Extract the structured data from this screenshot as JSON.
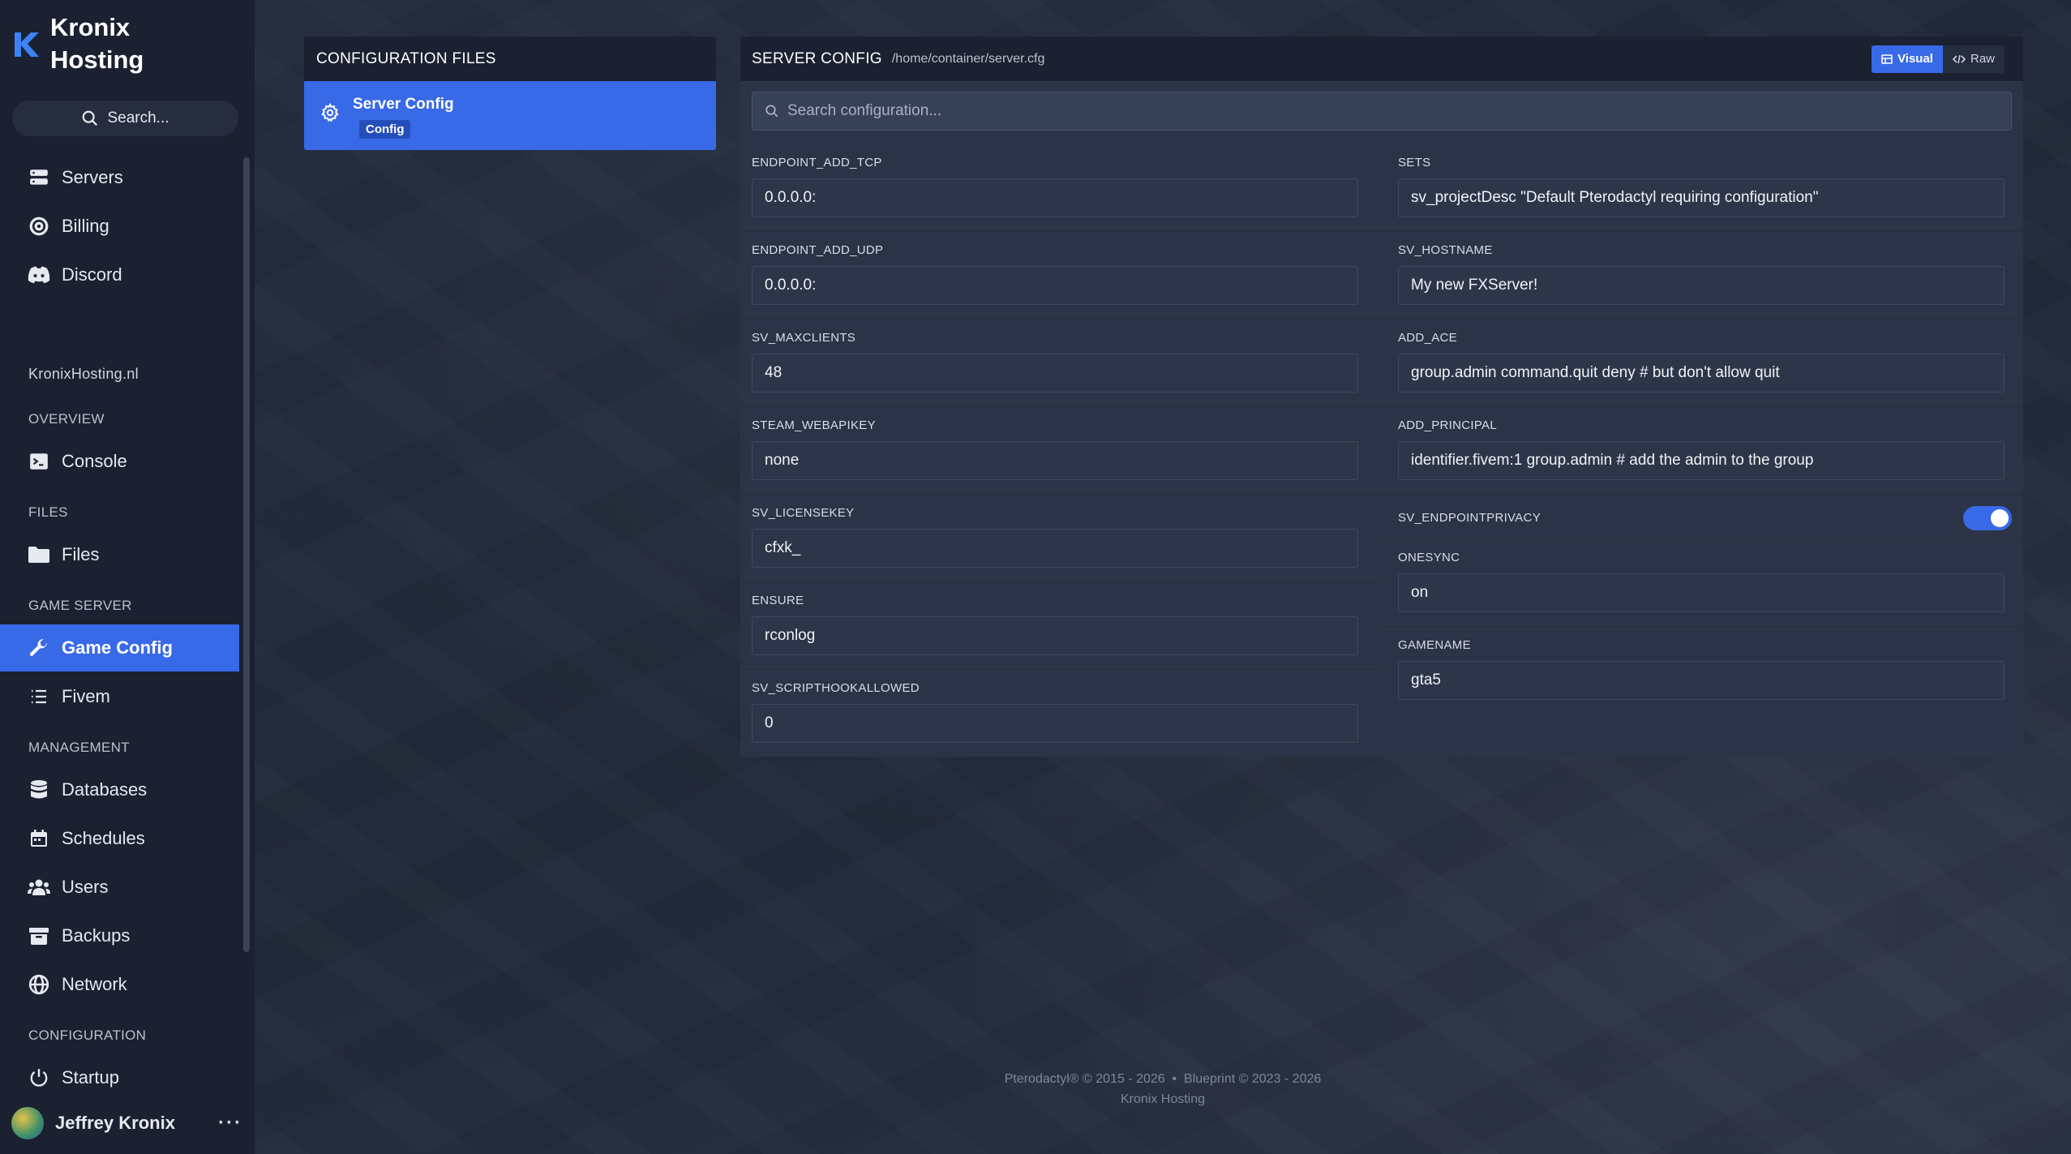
{
  "brand": {
    "line1": "Kronix",
    "line2": "Hosting"
  },
  "sidebar": {
    "search_label": "Search...",
    "top_items": [
      {
        "label": "Servers",
        "icon": "server-icon"
      },
      {
        "label": "Billing",
        "icon": "lifebuoy-icon"
      },
      {
        "label": "Discord",
        "icon": "discord-icon"
      }
    ],
    "site_label": "KronixHosting.nl",
    "sections": {
      "overview": "OVERVIEW",
      "files": "FILES",
      "game_server": "GAME SERVER",
      "management": "MANAGEMENT",
      "configuration": "CONFIGURATION"
    },
    "items": {
      "console": "Console",
      "files": "Files",
      "game_config": "Game Config",
      "fivem": "Fivem",
      "databases": "Databases",
      "schedules": "Schedules",
      "users": "Users",
      "backups": "Backups",
      "network": "Network",
      "startup": "Startup"
    },
    "user_name": "Jeffrey Kronix",
    "user_menu": "···"
  },
  "files_panel": {
    "header": "CONFIGURATION FILES",
    "items": [
      {
        "title": "Server Config",
        "badge": "Config"
      }
    ]
  },
  "config": {
    "title": "SERVER CONFIG",
    "path": "/home/container/server.cfg",
    "visual_label": "Visual",
    "raw_label": "Raw",
    "search_placeholder": "Search configuration...",
    "left_fields": [
      {
        "key": "ENDPOINT_ADD_TCP",
        "value": "0.0.0.0:"
      },
      {
        "key": "ENDPOINT_ADD_UDP",
        "value": "0.0.0.0:"
      },
      {
        "key": "SV_MAXCLIENTS",
        "value": "48"
      },
      {
        "key": "STEAM_WEBAPIKEY",
        "value": "none"
      },
      {
        "key": "SV_LICENSEKEY",
        "value": "cfxk_"
      },
      {
        "key": "ENSURE",
        "value": "rconlog"
      },
      {
        "key": "SV_SCRIPTHOOKALLOWED",
        "value": "0"
      }
    ],
    "right_fields": [
      {
        "key": "SETS",
        "value": "sv_projectDesc \"Default Pterodactyl requiring configuration\""
      },
      {
        "key": "SV_HOSTNAME",
        "value": "My new FXServer!"
      },
      {
        "key": "ADD_ACE",
        "value": "group.admin command.quit deny # but don't allow quit"
      },
      {
        "key": "ADD_PRINCIPAL",
        "value": "identifier.fivem:1 group.admin # add the admin to the group"
      },
      {
        "key": "SV_ENDPOINTPRIVACY",
        "toggle": true
      },
      {
        "key": "ONESYNC",
        "value": "on"
      },
      {
        "key": "GAMENAME",
        "value": "gta5"
      }
    ]
  },
  "footer": {
    "line1": "Pterodactyl® © 2015 - 2026  •  Blueprint © 2023 - 2026",
    "line2": "Kronix Hosting"
  },
  "colors": {
    "accent": "#3869e6",
    "sidebar": "#1b2130",
    "panel": "#2b3446"
  }
}
